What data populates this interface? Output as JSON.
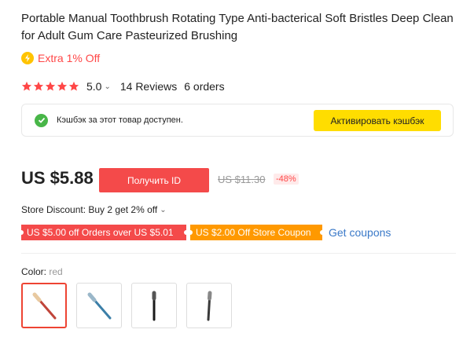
{
  "product": {
    "title": "Portable Manual Toothbrush Rotating Type Anti-bacterical Soft Bristles Deep Clean for Adult Gum Care Pasteurized Brushing",
    "extra_offer": "Extra 1% Off",
    "rating": {
      "stars_filled": 5,
      "stars_total": 5,
      "value": "5.0",
      "reviews": "14 Reviews",
      "orders": "6 orders"
    }
  },
  "cashback": {
    "text": "Кэшбэк за этот товар доступен.",
    "button_label": "Активировать кэшбэк"
  },
  "pricing": {
    "price": "US $5.88",
    "get_id_button": "Получить ID",
    "old_price": "US $11.30",
    "discount": "-48%"
  },
  "store_discount": {
    "text": "Store Discount: Buy 2 get 2% off"
  },
  "coupons": [
    {
      "text": "US $5.00 off Orders over US $5.01"
    },
    {
      "text": "US $2.00 Off Store Coupon"
    }
  ],
  "get_coupons_label": "Get coupons",
  "color": {
    "label": "Color:",
    "selected": "red",
    "options": [
      "red",
      "blue",
      "black",
      "gray"
    ]
  },
  "colors": {
    "accent_red": "#f44a4a",
    "star_red": "#ff4747",
    "cashback_yellow": "#ffdd00",
    "coupon_orange": "#ff9900",
    "link_blue": "#3a79c8"
  }
}
